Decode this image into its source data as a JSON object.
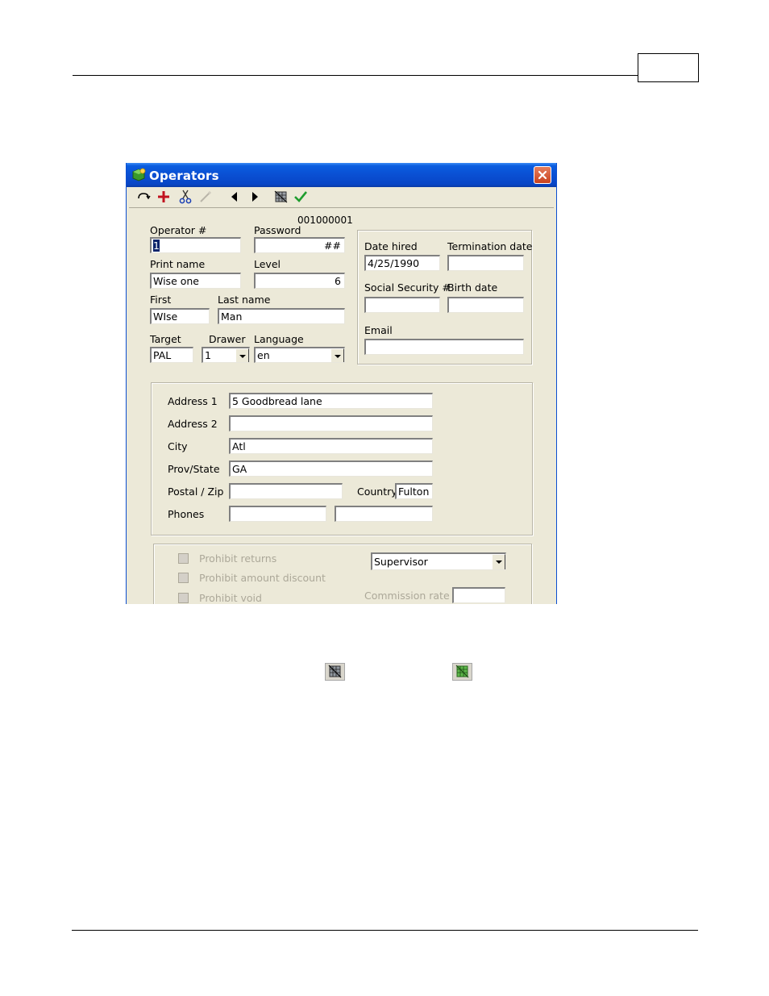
{
  "window": {
    "title": "Operators",
    "operator_id_display": "001000001"
  },
  "toolbar": {
    "items": [
      "undo-icon",
      "add-icon",
      "cut-icon",
      "wand-icon",
      "prev-icon",
      "next-icon",
      "grid-icon",
      "check-icon"
    ]
  },
  "form": {
    "operator_no": {
      "label": "Operator  #",
      "value": "1"
    },
    "password": {
      "label": "Password",
      "value": "##"
    },
    "print_name": {
      "label": "Print name",
      "value": "Wise  one"
    },
    "level": {
      "label": "Level",
      "value": "6"
    },
    "first": {
      "label": "First",
      "value": "WIse"
    },
    "last_name": {
      "label": "Last name",
      "value": "Man"
    },
    "target": {
      "label": "Target",
      "value": "PAL"
    },
    "drawer": {
      "label": "Drawer",
      "value": "1"
    },
    "language": {
      "label": "Language",
      "value": "en"
    },
    "date_hired": {
      "label": "Date hired",
      "value": "4/25/1990"
    },
    "termination_date": {
      "label": "Termination date",
      "value": ""
    },
    "ssn": {
      "label": "Social Security #",
      "value": ""
    },
    "birth_date": {
      "label": "Birth date",
      "value": ""
    },
    "email": {
      "label": "Email",
      "value": ""
    }
  },
  "address": {
    "address1": {
      "label": "Address 1",
      "value": "5 Goodbread lane"
    },
    "address2": {
      "label": "Address 2",
      "value": ""
    },
    "city": {
      "label": "City",
      "value": "Atl"
    },
    "prov_state": {
      "label": "Prov/State",
      "value": "GA"
    },
    "postal_zip": {
      "label": "Postal / Zip",
      "value": ""
    },
    "country": {
      "label": "Country",
      "value": "Fulton"
    },
    "phones": {
      "label": "Phones",
      "value1": "",
      "value2": ""
    }
  },
  "permissions": {
    "prohibit_returns": "Prohibit returns",
    "prohibit_amount_discount": "Prohibit amount discount",
    "prohibit_void": "Prohibit void",
    "role": "Supervisor",
    "commission_rate_label": "Commission rate",
    "commission_rate_value": ""
  },
  "colors": {
    "titlebar": "#0a4fd3",
    "window_bg": "#ece9d8",
    "close_button": "#c9421e"
  },
  "inline_icons": [
    "grid-off-icon",
    "grid-on-icon"
  ]
}
